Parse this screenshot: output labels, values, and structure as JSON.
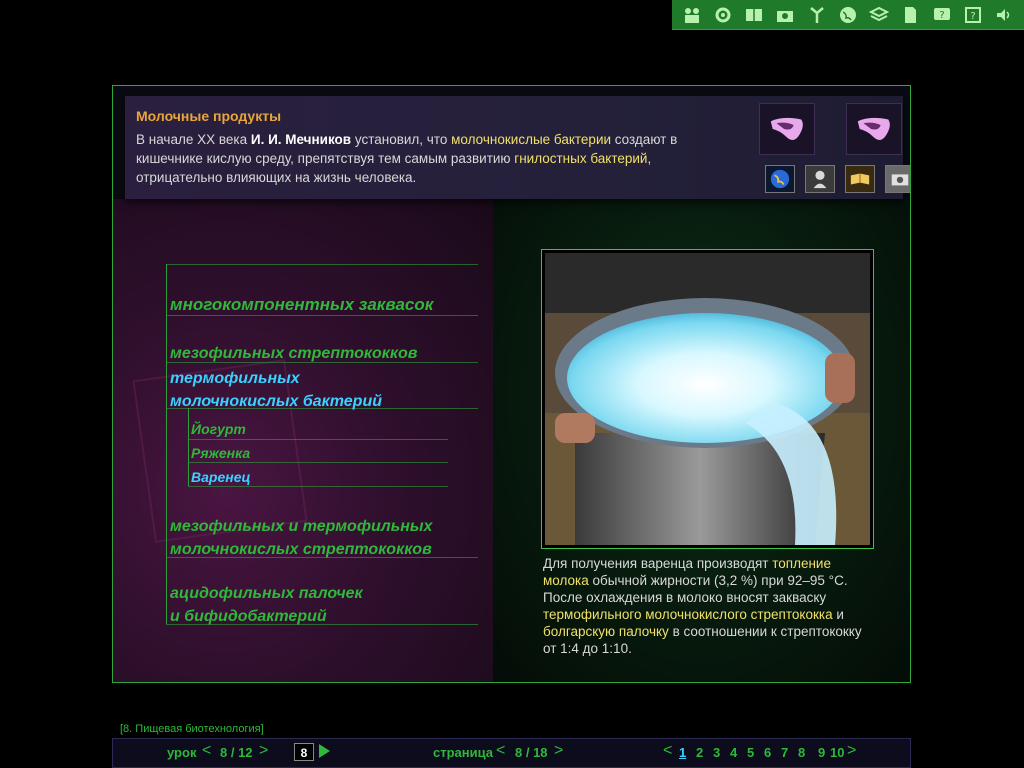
{
  "toolbar": {
    "icons": [
      "people-icon",
      "gear-icon",
      "book-icon",
      "camera-icon",
      "antenna-icon",
      "globe-icon",
      "layers-icon",
      "document-icon",
      "question-bubble-icon",
      "help-icon",
      "sound-icon"
    ]
  },
  "header": {
    "title": "Молочные продукты",
    "intro_p1": "В начале XX века ",
    "intro_name": "И. И. Мечников",
    "intro_p2": " установил, что ",
    "intro_hl1": "молочнокислые бактерии",
    "intro_p3": " создают в кишечнике кислую среду, препятствуя тем самым развитию ",
    "intro_hl2": "гнилостных бактерий",
    "intro_p4": ", отрицательно влияющих на жизнь человека."
  },
  "tree": {
    "items": [
      {
        "label": "многокомпонентных заквасок"
      },
      {
        "label": "мезофильных стрептококков"
      },
      {
        "label1": "термофильных",
        "label2": "молочнокислых бактерий"
      },
      {
        "label1": "мезофильных и термофильных",
        "label2": "молочнокислых стрептококков"
      },
      {
        "label1": "ацидофильных палочек",
        "label2": "и бифидобактерий"
      }
    ],
    "subitems": [
      {
        "label": "Йогурт"
      },
      {
        "label": "Ряженка"
      },
      {
        "label": "Варенец"
      }
    ]
  },
  "caption": {
    "p1": "Для получения варенца производят ",
    "hl1": "топление молока",
    "p2": " обычной жирности (3,2 %) при 92–95 °C. После охлаждения в молоко вносят закваску ",
    "hl2": "термофильного молочнокислого стрептококка",
    "p3": " и ",
    "hl3": "болгарскую палочку",
    "p4": " в соотношении к стрептококку от 1:4 до 1:10."
  },
  "footer": {
    "breadcrumb": "[8. Пищевая биотехнология]",
    "lesson_label": "урок",
    "lesson_value": "8 / 12",
    "page_input": "8",
    "page_label": "страница",
    "page_value": "8 / 18",
    "subpages": [
      "1",
      "2",
      "3",
      "4",
      "5",
      "6",
      "7",
      "8",
      "9",
      "10"
    ],
    "current_subpage": "1"
  },
  "colors": {
    "accent_green": "#2fb839",
    "highlight_yellow": "#f0e06a",
    "active_cyan": "#3ad0ff",
    "title_orange": "#e8a53a"
  }
}
